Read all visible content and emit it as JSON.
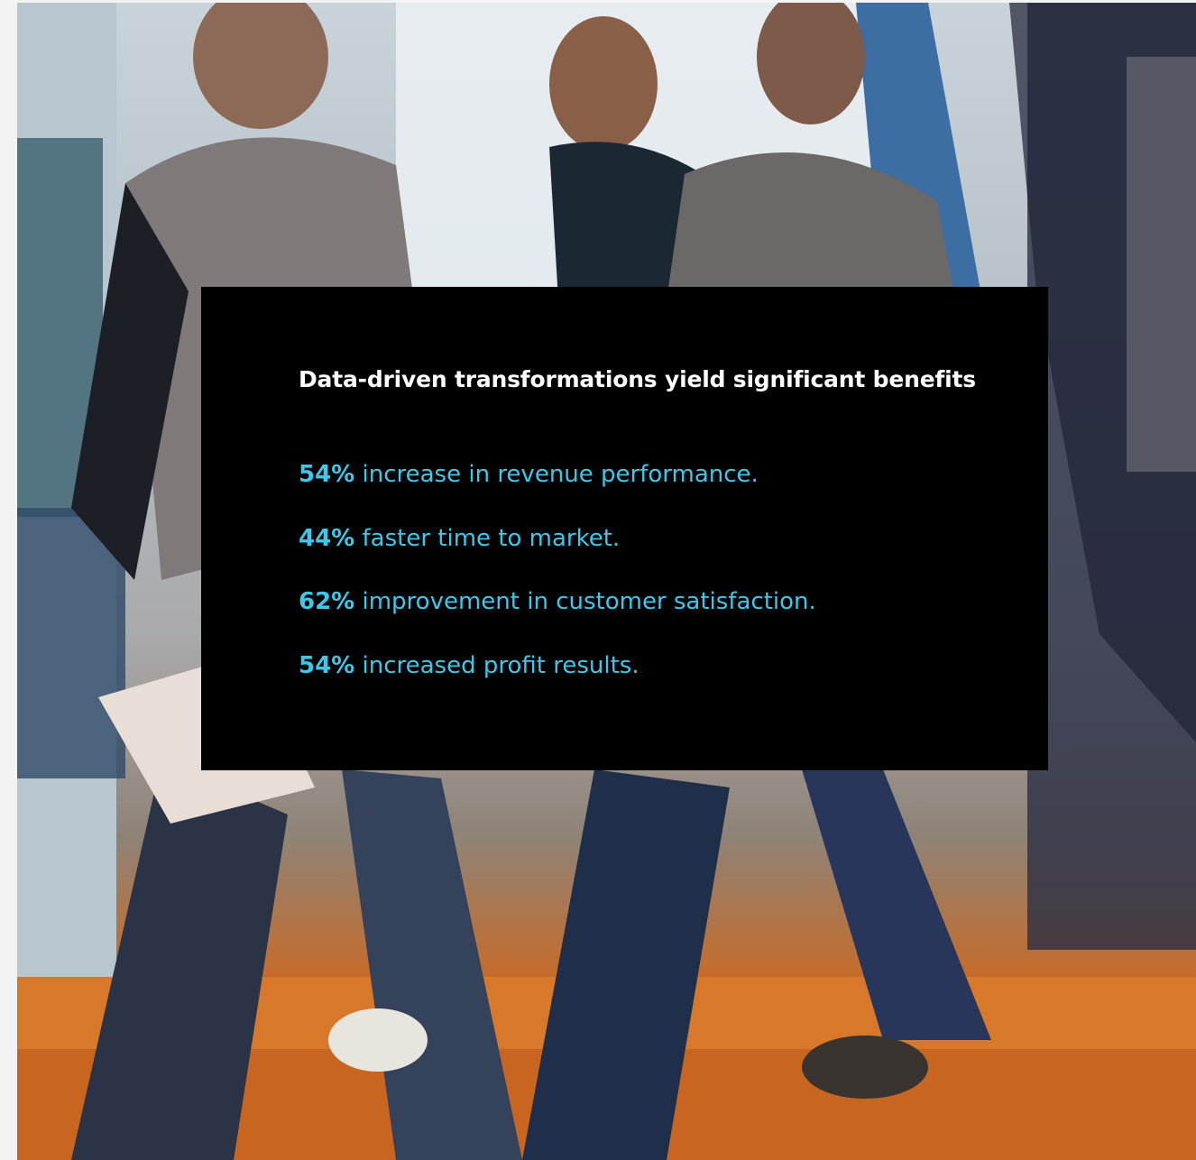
{
  "card": {
    "title": "Data-driven transformations yield significant benefits",
    "accent_color": "#3cc8ea",
    "background_color": "#000000"
  },
  "stats": [
    {
      "value": "54%",
      "text": " increase in revenue performance."
    },
    {
      "value": "44%",
      "text": " faster time to market."
    },
    {
      "value": "62%",
      "text": " improvement in customer satisfaction."
    },
    {
      "value": "54%",
      "text": " increased profit results."
    }
  ]
}
